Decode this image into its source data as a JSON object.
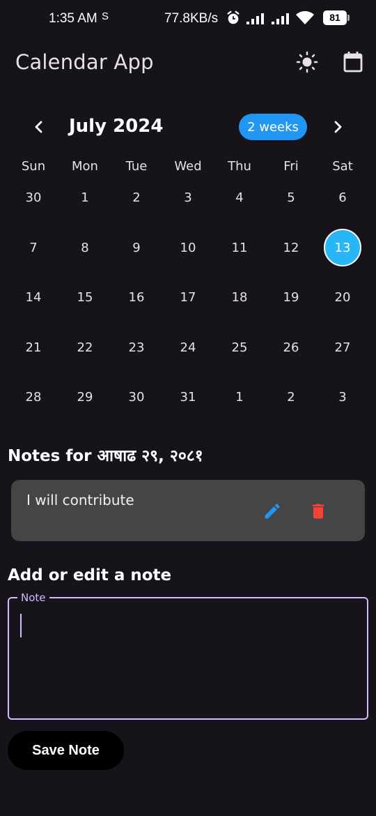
{
  "status_bar": {
    "time": "1:35 AM",
    "s_icon": "S",
    "network_speed": "77.8KB/s",
    "battery": "81",
    "icons": [
      "alarm-icon",
      "signal-icon",
      "signal-icon",
      "wifi-icon"
    ]
  },
  "app_bar": {
    "title": "Calendar App",
    "icons": [
      "brightness-icon",
      "calendar-icon"
    ]
  },
  "calendar": {
    "month_label": "July 2024",
    "format_button": "2 weeks",
    "weekdays": [
      "Sun",
      "Mon",
      "Tue",
      "Wed",
      "Thu",
      "Fri",
      "Sat"
    ],
    "weeks": [
      [
        "30",
        "1",
        "2",
        "3",
        "4",
        "5",
        "6"
      ],
      [
        "7",
        "8",
        "9",
        "10",
        "11",
        "12",
        "13"
      ],
      [
        "14",
        "15",
        "16",
        "17",
        "18",
        "19",
        "20"
      ],
      [
        "21",
        "22",
        "23",
        "24",
        "25",
        "26",
        "27"
      ],
      [
        "28",
        "29",
        "30",
        "31",
        "1",
        "2",
        "3"
      ]
    ],
    "selected_day": "13",
    "accent_color": "#29b6f6"
  },
  "notes": {
    "title": "Notes for आषाढ २९, २०८१",
    "items": [
      {
        "text": "I will contribute"
      }
    ]
  },
  "editor": {
    "title": "Add or edit a note",
    "field_label": "Note",
    "field_value": "",
    "save_label": "Save Note"
  },
  "colors": {
    "background": "#16141a",
    "button_blue": "#2196f3",
    "edit_icon": "#2196f3",
    "delete_icon": "#f44336",
    "field_border": "#d0bcff"
  }
}
